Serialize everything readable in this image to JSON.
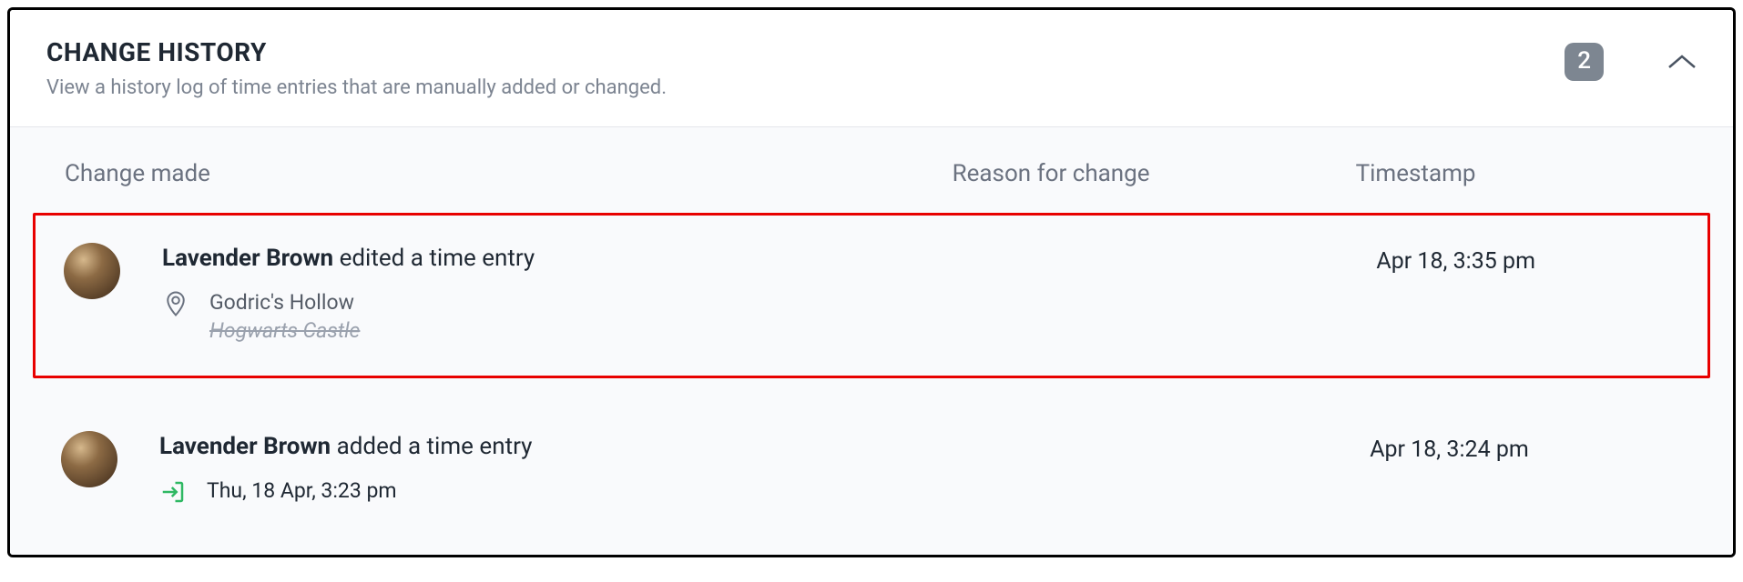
{
  "header": {
    "title": "CHANGE HISTORY",
    "subtitle": "View a history log of time entries that are manually added or changed.",
    "count": "2"
  },
  "columns": {
    "change": "Change made",
    "reason": "Reason for change",
    "timestamp": "Timestamp"
  },
  "entries": [
    {
      "user": "Lavender Brown",
      "action": "edited a time entry",
      "timestamp": "Apr 18, 3:35 pm",
      "detail_current": "Godric's Hollow",
      "detail_previous": "Hogwarts Castle"
    },
    {
      "user": "Lavender Brown",
      "action": "added a time entry",
      "timestamp": "Apr 18, 3:24 pm",
      "detail_single": "Thu, 18 Apr, 3:23 pm"
    }
  ]
}
